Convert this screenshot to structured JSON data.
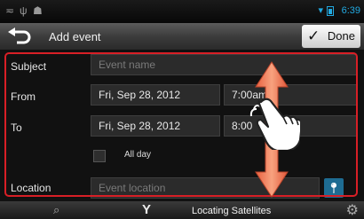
{
  "status_bar": {
    "time": "6:39",
    "icons": [
      "usb-icon",
      "usb-debug-icon",
      "android-icon",
      "wifi-icon",
      "battery-icon"
    ]
  },
  "action_bar": {
    "title": "Add event",
    "done_label": "Done"
  },
  "form": {
    "subject": {
      "label": "Subject",
      "placeholder": "Event name"
    },
    "from": {
      "label": "From",
      "date": "Fri, Sep 28, 2012",
      "time": "7:00am"
    },
    "to": {
      "label": "To",
      "date": "Fri, Sep 28, 2012",
      "time": "8:00"
    },
    "all_day": {
      "label": "All day",
      "checked": false
    },
    "location": {
      "label": "Location",
      "placeholder": "Event location"
    }
  },
  "bottom_bar": {
    "status": "Locating Satellites"
  },
  "colors": {
    "highlight_frame": "#d81f26",
    "arrow": "#f07a5a",
    "status_accent": "#22a9e0"
  }
}
